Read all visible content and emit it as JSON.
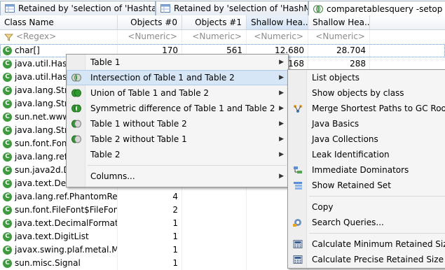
{
  "tabs": [
    {
      "label": "Retained by 'selection of 'Hashtable'",
      "icon": "table-icon"
    },
    {
      "label": "Retained by 'selection of 'HashMap'",
      "icon": "table-icon"
    },
    {
      "label": "comparetablesquery  -setop ALL",
      "icon": "compare-icon"
    }
  ],
  "table": {
    "columns": [
      "Class Name",
      "Objects #0",
      "Objects #1",
      "Shallow Hea...",
      "Shallow Hea..."
    ],
    "filters": [
      "<Regex>",
      "<Numeric>",
      "<Numeric>",
      "<Numeric>",
      "<Numeric>"
    ],
    "rows": [
      {
        "name": "char[]",
        "o0": "170",
        "o1": "561",
        "s0": "12.680",
        "s1": "28.704"
      },
      {
        "name": "java.util.Hash",
        "o0": "",
        "o1": "",
        "s0": "168",
        "s1": "288"
      },
      {
        "name": "java.util.Hash",
        "o0": "",
        "o1": "",
        "s0": "",
        "s1": ""
      },
      {
        "name": "java.lang.Strin",
        "o0": "",
        "o1": "",
        "s0": "",
        "s1": ""
      },
      {
        "name": "java.lang.Strin",
        "o0": "",
        "o1": "",
        "s0": "",
        "s1": ""
      },
      {
        "name": "sun.net.www.",
        "o0": "",
        "o1": "",
        "s0": "",
        "s1": ""
      },
      {
        "name": "java.lang.Strin",
        "o0": "",
        "o1": "",
        "s0": "",
        "s1": ""
      },
      {
        "name": "sun.font.Font",
        "o0": "",
        "o1": "",
        "s0": "",
        "s1": ""
      },
      {
        "name": "java.lang.ref.W",
        "o0": "",
        "o1": "",
        "s0": "",
        "s1": ""
      },
      {
        "name": "sun.java2d.De",
        "o0": "",
        "o1": "",
        "s0": "",
        "s1": ""
      },
      {
        "name": "java.text.DecimalFormat",
        "o0": "",
        "o1": "",
        "s0": "",
        "s1": ""
      },
      {
        "name": "java.lang.ref.PhantomRef...",
        "o0": "4",
        "o1": "",
        "s0": "",
        "s1": ""
      },
      {
        "name": "sun.font.FileFont$FileFon...",
        "o0": "2",
        "o1": "",
        "s0": "",
        "s1": ""
      },
      {
        "name": "java.text.DecimalFormatS...",
        "o0": "1",
        "o1": "",
        "s0": "",
        "s1": ""
      },
      {
        "name": "java.text.DigitList",
        "o0": "1",
        "o1": "",
        "s0": "",
        "s1": ""
      },
      {
        "name": "javax.swing.plaf.metal.M...",
        "o0": "1",
        "o1": "",
        "s0": "",
        "s1": ""
      },
      {
        "name": "sun.misc.Signal",
        "o0": "1",
        "o1": "",
        "s0": "",
        "s1": ""
      }
    ]
  },
  "context_menu": {
    "items": [
      {
        "label": "Table 1",
        "icon": "",
        "submenu": true
      },
      {
        "label": "Intersection of Table 1 and Table 2",
        "icon": "intersection-icon",
        "submenu": true
      },
      {
        "label": "Union of Table 1 and Table 2",
        "icon": "union-icon",
        "submenu": true
      },
      {
        "label": "Symmetric difference of Table 1 and Table 2",
        "icon": "symmetric-difference-icon",
        "submenu": true
      },
      {
        "label": "Table 1 without Table 2",
        "icon": "difference-icon",
        "submenu": true
      },
      {
        "label": "Table 2 without Table 1",
        "icon": "difference-icon",
        "submenu": true
      },
      {
        "label": "Table 2",
        "icon": "",
        "submenu": true
      },
      {
        "label": "Columns...",
        "icon": "",
        "submenu": true
      }
    ]
  },
  "submenu": {
    "items": [
      {
        "label": "List objects",
        "icon": ""
      },
      {
        "label": "Show objects by class",
        "icon": ""
      },
      {
        "label": "Merge Shortest Paths to GC Roots",
        "icon": "paths-icon"
      },
      {
        "label": "Java Basics",
        "icon": ""
      },
      {
        "label": "Java Collections",
        "icon": ""
      },
      {
        "label": "Leak Identification",
        "icon": ""
      },
      {
        "label": "Immediate Dominators",
        "icon": "dominator-icon"
      },
      {
        "label": "Show Retained Set",
        "icon": "retained-set-icon"
      },
      {
        "label": "Copy",
        "icon": ""
      },
      {
        "label": "Search Queries...",
        "icon": "search-queries-icon"
      },
      {
        "label": "Calculate Minimum Retained Size (q",
        "icon": "calculator-icon"
      },
      {
        "label": "Calculate Precise Retained Size",
        "icon": "calculator-icon"
      }
    ]
  }
}
